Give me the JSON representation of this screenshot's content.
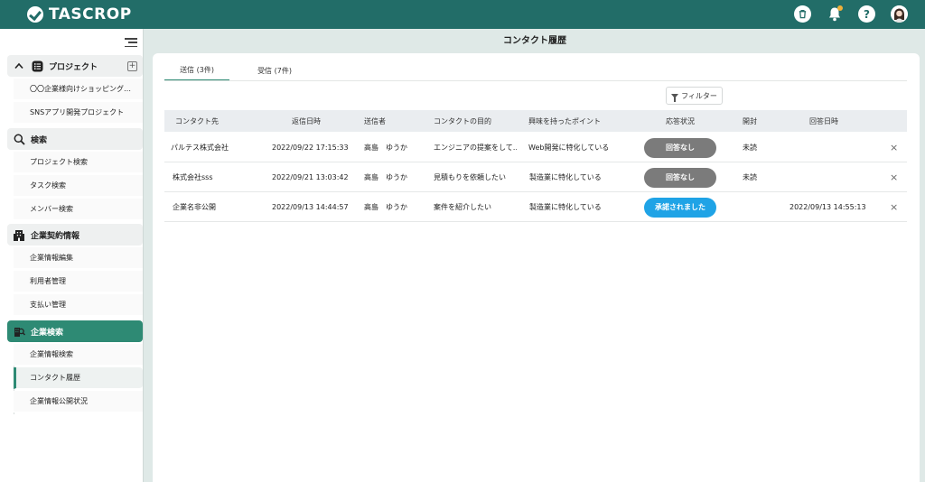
{
  "app": {
    "name": "TASCROP"
  },
  "topbar": {
    "icons": [
      "trash-icon",
      "bell-icon",
      "help-icon",
      "user-avatar"
    ],
    "help_label": "?",
    "trash_label": "🗑"
  },
  "sidebar": {
    "sections": [
      {
        "label": "プロジェクト",
        "icon": "project-list-icon",
        "items": [
          "〇〇企業様向けショッピング…",
          "SNSアプリ開発プロジェクト"
        ]
      },
      {
        "label": "検索",
        "icon": "search-icon",
        "items": [
          "プロジェクト検索",
          "タスク検索",
          "メンバー検索"
        ]
      },
      {
        "label": "企業契約情報",
        "icon": "building-icon",
        "items": [
          "企業情報編集",
          "利用者管理",
          "支払い管理"
        ]
      },
      {
        "label": "企業検索",
        "icon": "company-search-icon",
        "items": [
          "企業情報検索",
          "コンタクト履歴",
          "企業情報公開状況"
        ]
      }
    ],
    "collapse_arrow": "^",
    "plus": "+"
  },
  "main": {
    "title": "コンタクト履歴",
    "tabs": [
      {
        "label": "送信 (3件)",
        "active": true
      },
      {
        "label": "受信 (7件)",
        "active": false
      }
    ],
    "filter_label": "フィルター",
    "columns": [
      "コンタクト先",
      "返信日時",
      "送信者",
      "コンタクトの目的",
      "興味を持ったポイント",
      "応答状況",
      "開封",
      "回答日時"
    ],
    "rows": [
      {
        "company": "パルテス株式会社",
        "date": "2022/09/22 17:15:33",
        "sender": "高島　ゆうか",
        "purpose": "エンジニアの提案をして…",
        "interest": "Web開発に特化している",
        "status": "回答なし",
        "status_color": "#7b7b7b",
        "opened": "未読",
        "answer_date": ""
      },
      {
        "company": "株式会社sss",
        "date": "2022/09/21 13:03:42",
        "sender": "高島　ゆうか",
        "purpose": "見積もりを依頼したい",
        "interest": "製造業に特化している",
        "status": "回答なし",
        "status_color": "#7b7b7b",
        "opened": "未読",
        "answer_date": ""
      },
      {
        "company": "企業名非公開",
        "date": "2022/09/13 14:44:57",
        "sender": "高島　ゆうか",
        "purpose": "案件を紹介したい",
        "interest": "製造業に特化している",
        "status": "承諾されました",
        "status_color": "#1fa3e6",
        "opened": "",
        "answer_date": "2022/09/13 14:55:13"
      }
    ],
    "close_symbol": "×"
  }
}
